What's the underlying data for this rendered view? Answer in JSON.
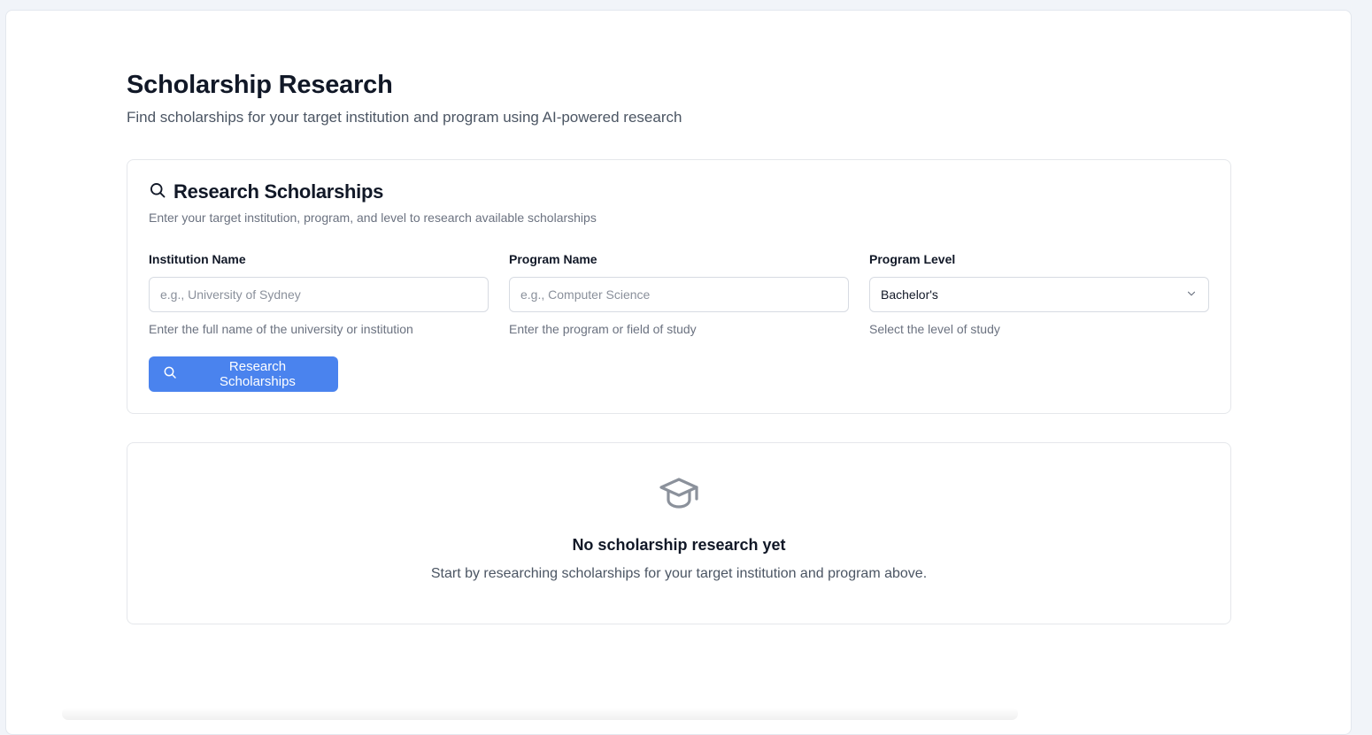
{
  "header": {
    "title": "Scholarship Research",
    "subtitle": "Find scholarships for your target institution and program using AI-powered research"
  },
  "research_card": {
    "icon": "search-icon",
    "title": "Research Scholarships",
    "description": "Enter your target institution, program, and level to research available scholarships",
    "fields": {
      "institution": {
        "label": "Institution Name",
        "value": "",
        "placeholder": "e.g., University of Sydney",
        "hint": "Enter the full name of the university or institution"
      },
      "program": {
        "label": "Program Name",
        "value": "",
        "placeholder": "e.g., Computer Science",
        "hint": "Enter the program or field of study"
      },
      "level": {
        "label": "Program Level",
        "selected": "Bachelor's",
        "hint": "Select the level of study",
        "icon": "chevron-down-icon"
      }
    },
    "submit_label": "Research Scholarships",
    "submit_icon": "search-icon"
  },
  "empty_state": {
    "icon": "graduation-cap-icon",
    "title": "No scholarship research yet",
    "text": "Start by researching scholarships for your target institution and program above."
  },
  "colors": {
    "primary": "#4a83ee",
    "background": "#f1f4f9",
    "card_border": "#e5e7eb",
    "muted_text": "#6b7280"
  }
}
